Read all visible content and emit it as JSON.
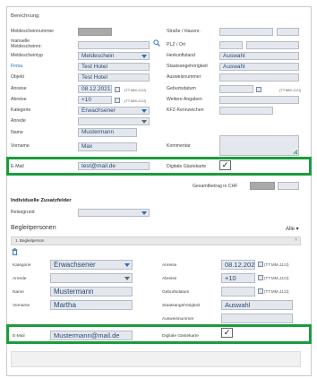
{
  "section_title": "Berechnung:",
  "left": {
    "meldescheinnummer_label": "Meldescheinnummer",
    "manuelle_label": "manuelle Meldescheinnr.",
    "meldescheintyp_label": "Meldescheintyp",
    "meldescheintyp_value": "Meldeschein",
    "firma_label": "Firma",
    "firma_value": "Test Hotel",
    "objekt_label": "Objekt",
    "objekt_value": "Test Hotel",
    "anreise_label": "Anreise",
    "anreise_value": "08.12.2021",
    "abreise_label": "Abreise",
    "abreise_value": "+10",
    "date_format": "(TT.MM.JJJJ)",
    "kategorie_label": "Kategorie",
    "kategorie_value": "Erwachsener",
    "anrede_label": "Anrede",
    "name_label": "Name",
    "name_value": "Mustermann",
    "vorname_label": "Vorname",
    "vorname_value": "Max",
    "email_label": "E-Mail",
    "email_value": "test@mail.de"
  },
  "right": {
    "strasse_label": "Straße / Hausnr.",
    "plz_label": "PLZ / Ort",
    "herkunft_label": "Herkunftsland",
    "herkunft_value": "Auswahl",
    "staats_label": "Staatsangehörigkeit",
    "staats_value": "Auswahl",
    "ausweis_label": "Ausweisnummer",
    "geburt_label": "Geburtsdatum",
    "date_format": "(TT.MM.JJJJ)",
    "weitere_label": "Weitere Angaben",
    "kfz_label": "KFZ-Kennzeichen",
    "kommentar_label": "Kommentar",
    "gaestekarte_label": "Digitale Gästekarte",
    "gesamt_label": "Gesamtbetrag in CHF"
  },
  "zusatz": {
    "title": "Individuelle Zusatzfelder",
    "reisegrund_label": "Reisegrund"
  },
  "begleit": {
    "title": "Begleitpersonen",
    "alle_label": "Alle",
    "tab_label": "1. Begleitperson",
    "kategorie_label": "Kategorie",
    "kategorie_value": "Erwachsener",
    "anrede_label": "Anrede",
    "name_label": "Name",
    "name_value": "Mustermann",
    "vorname_label": "Vorname",
    "vorname_value": "Martha",
    "email_label": "E-Mail",
    "email_value": "Mustermann@mail.de",
    "anreise_label": "Anreise",
    "anreise_value": "08.12.2021",
    "abreise_label": "Abreise",
    "abreise_value": "+10",
    "date_format": "(TT.MM.JJJJ)",
    "geburt_label": "Geburtsdatum",
    "staats_label": "Staatsangehörigkeit",
    "staats_value": "Auswahl",
    "ausweis_label": "Ausweisnummer",
    "gaestekarte_label": "Digitale Gästekarte"
  },
  "checkmark": "✓",
  "icons": {
    "search": "search-icon",
    "calendar": "calendar-icon",
    "trash": "trash-icon"
  },
  "colors": {
    "highlight": "#1a9c3c",
    "link_blue": "#2d6fb8"
  }
}
